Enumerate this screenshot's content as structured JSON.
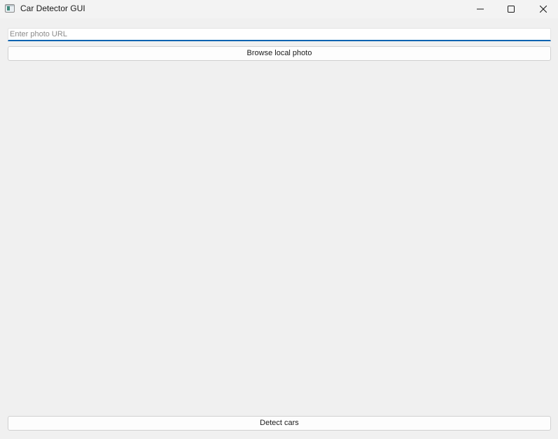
{
  "window": {
    "title": "Car Detector GUI",
    "icon": "app-window-icon",
    "controls": {
      "minimize_icon": "minimize-icon",
      "maximize_icon": "maximize-icon",
      "close_icon": "close-icon"
    }
  },
  "url_input": {
    "placeholder": "Enter photo URL",
    "value": ""
  },
  "browse_button": {
    "label": "Browse local photo"
  },
  "detect_button": {
    "label": "Detect cars"
  },
  "colors": {
    "window_bg": "#f0f0f0",
    "titlebar_bg": "#f3f3f3",
    "focus_accent": "#0063b1"
  }
}
